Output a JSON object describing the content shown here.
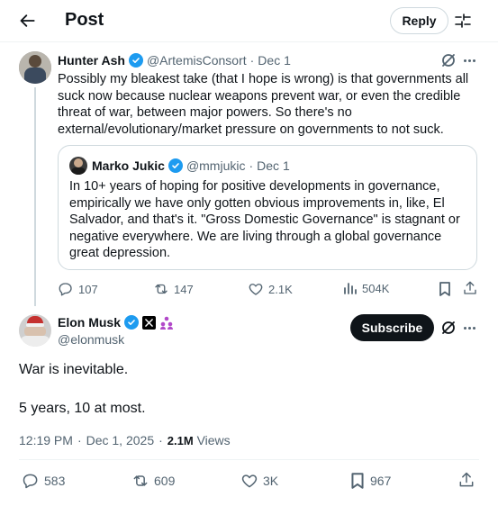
{
  "header": {
    "title": "Post",
    "reply_label": "Reply"
  },
  "parent_post": {
    "author_name": "Hunter Ash",
    "handle": "@ArtemisConsort",
    "separator": "·",
    "date": "Dec 1",
    "text": "Possibly my bleakest take (that I hope is wrong) is that governments all suck now because nuclear weapons prevent war, or even the credible threat of war, between major powers. So there's no external/evolutionary/market pressure on governments to not suck.",
    "quote": {
      "author_name": "Marko Jukic",
      "handle": "@mmjukic",
      "separator": "·",
      "date": "Dec 1",
      "text": "In 10+ years of hoping for positive developments in governance, empirically we have only gotten obvious improvements in, like, El Salvador, and that's it. \"Gross Domestic Governance\" is stagnant or negative everywhere. We are living through a global governance great depression."
    },
    "stats": {
      "replies": "107",
      "reposts": "147",
      "likes": "2.1K",
      "views": "504K"
    }
  },
  "main_post": {
    "author_name": "Elon Musk",
    "handle": "@elonmusk",
    "subscribe_label": "Subscribe",
    "text_line1": "War is inevitable.",
    "text_line2": "5 years, 10 at most.",
    "time": "12:19 PM",
    "separator": "·",
    "date": "Dec 1, 2025",
    "separator2": "·",
    "views_count": "2.1M",
    "views_label": "Views",
    "stats": {
      "replies": "583",
      "reposts": "609",
      "likes": "3K",
      "bookmarks": "967"
    }
  },
  "colors": {
    "verified": "#1d9bf0",
    "text": "#0f1419",
    "muted": "#536471",
    "border": "#cfd9de"
  }
}
